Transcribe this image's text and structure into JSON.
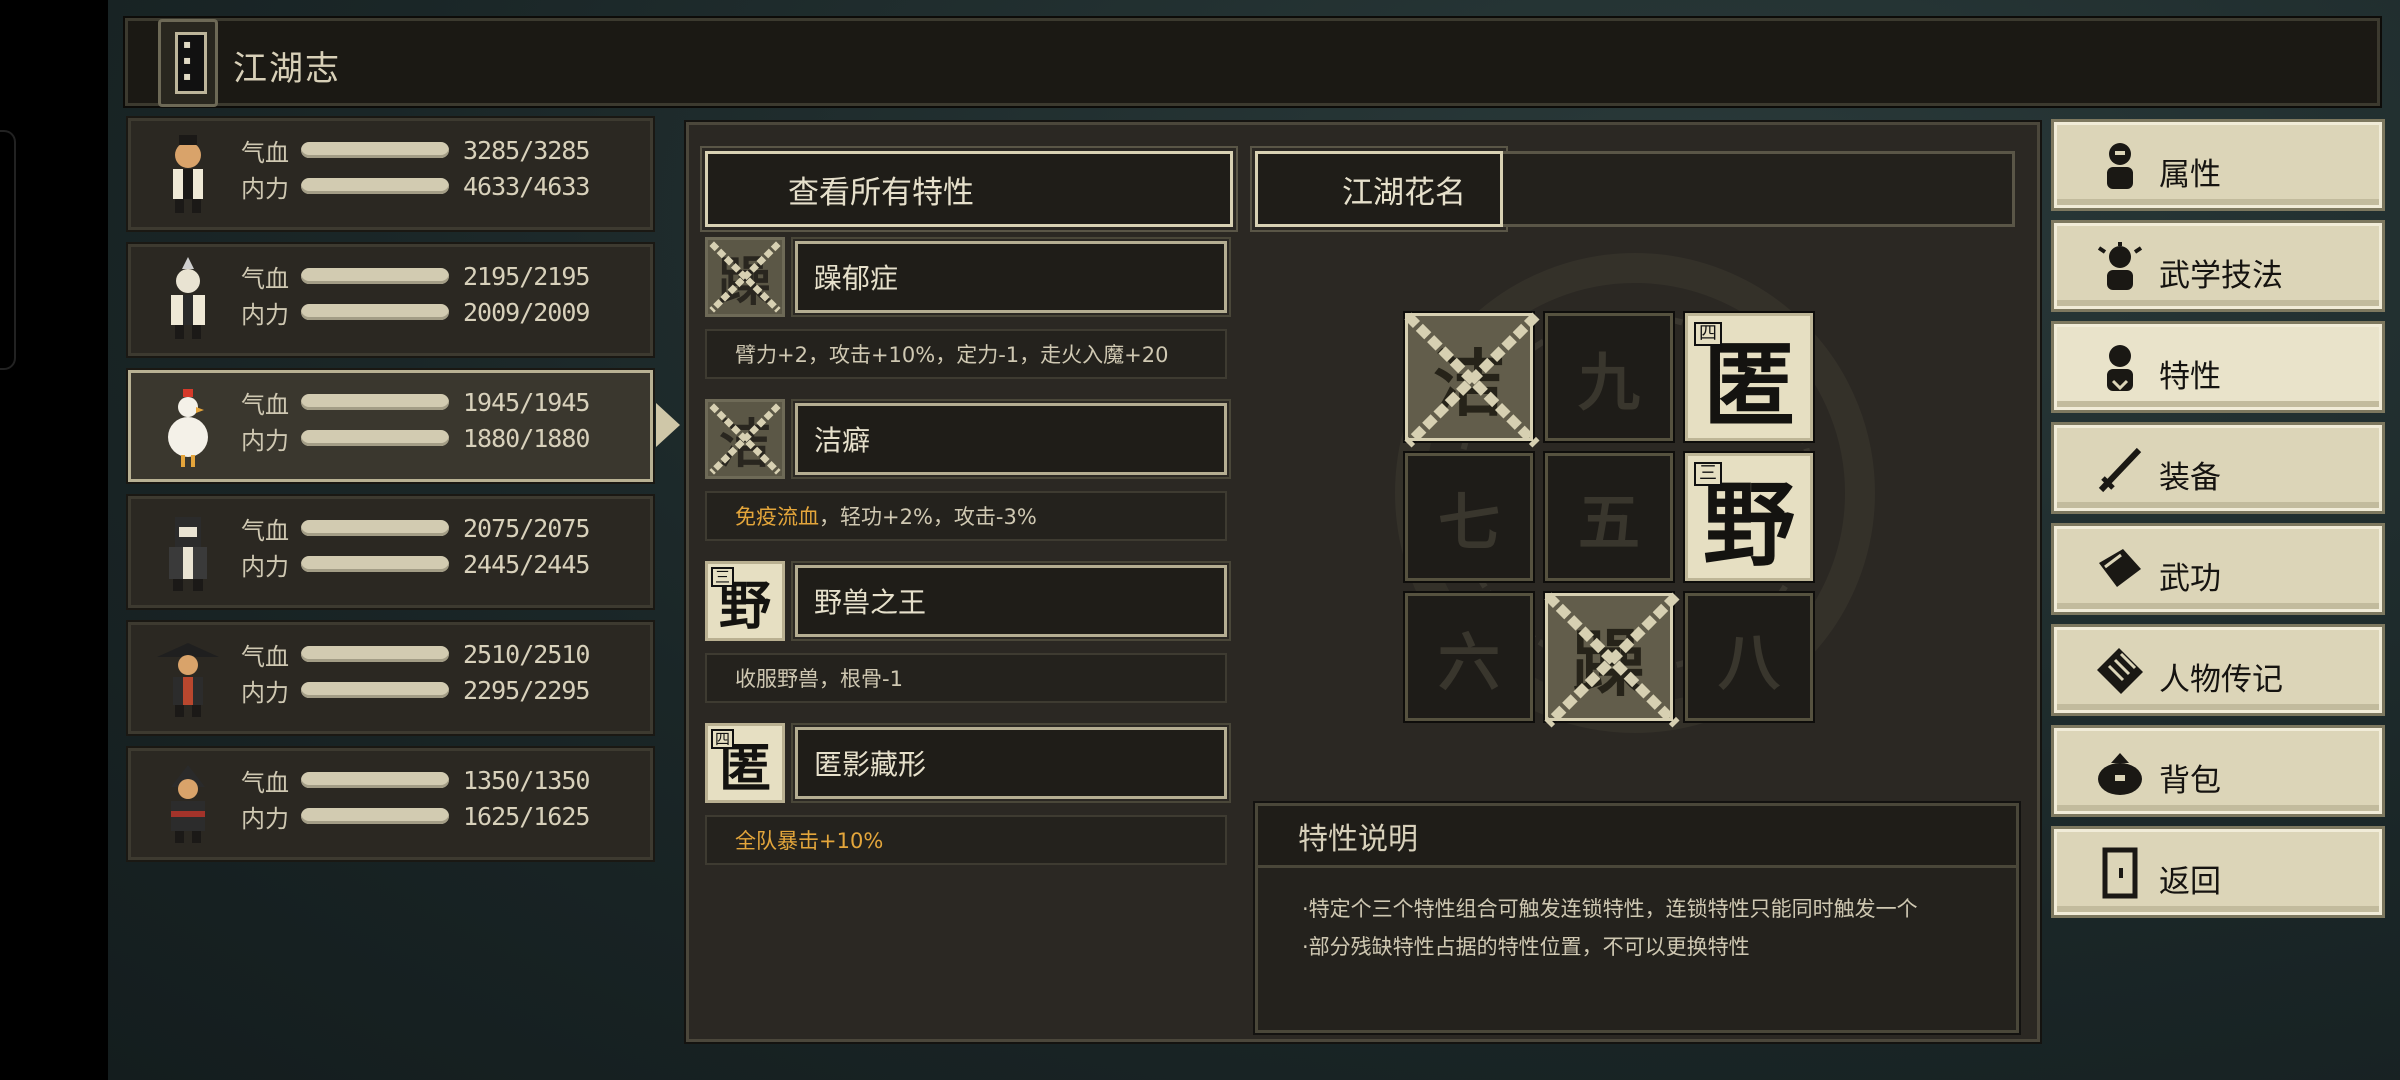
{
  "window_title": "江湖志",
  "party": [
    {
      "hp_label": "气血",
      "mp_label": "内力",
      "hp": "3285/3285",
      "mp": "4633/4633",
      "hp_frac": 1.0,
      "mp_frac": 1.0,
      "avatar": "warrior-avatar"
    },
    {
      "hp_label": "气血",
      "mp_label": "内力",
      "hp": "2195/2195",
      "mp": "2009/2009",
      "hp_frac": 1.0,
      "mp_frac": 1.0,
      "avatar": "monk-avatar"
    },
    {
      "hp_label": "气血",
      "mp_label": "内力",
      "hp": "1945/1945",
      "mp": "1880/1880",
      "hp_frac": 1.0,
      "mp_frac": 1.0,
      "avatar": "chicken-avatar"
    },
    {
      "hp_label": "气血",
      "mp_label": "内力",
      "hp": "2075/2075",
      "mp": "2445/2445",
      "hp_frac": 1.0,
      "mp_frac": 1.0,
      "avatar": "masked-avatar"
    },
    {
      "hp_label": "气血",
      "mp_label": "内力",
      "hp": "2510/2510",
      "mp": "2295/2295",
      "hp_frac": 1.0,
      "mp_frac": 1.0,
      "avatar": "hat-avatar"
    },
    {
      "hp_label": "气血",
      "mp_label": "内力",
      "hp": "1350/1350",
      "mp": "1625/1625",
      "hp_frac": 1.0,
      "mp_frac": 1.0,
      "avatar": "assassin-avatar"
    }
  ],
  "tabs": {
    "all_traits": "查看所有特性",
    "nickname": "江湖花名"
  },
  "traits": [
    {
      "glyph": "躁",
      "name": "躁郁症",
      "desc": "臂力+2，攻击+10%，定力-1，走火入魔+20",
      "highlight": "",
      "locked": true
    },
    {
      "glyph": "洁",
      "name": "洁癖",
      "desc": "，轻功+2%，攻击-3%",
      "highlight": "免疫流血",
      "locked": true
    },
    {
      "glyph": "野",
      "num": "三",
      "name": "野兽之王",
      "desc": "收服野兽，根骨-1",
      "highlight": "",
      "locked": false
    },
    {
      "glyph": "匿",
      "num": "四",
      "name": "匿影藏形",
      "desc": "全队暴击+10%",
      "highlight": "",
      "locked": false
    }
  ],
  "grid": [
    {
      "glyph": "洁",
      "state": "locked"
    },
    {
      "glyph": "九",
      "state": "empty"
    },
    {
      "glyph": "匿",
      "num": "四",
      "state": "gold"
    },
    {
      "glyph": "七",
      "state": "empty"
    },
    {
      "glyph": "五",
      "state": "empty"
    },
    {
      "glyph": "野",
      "num": "三",
      "state": "gold"
    },
    {
      "glyph": "六",
      "state": "empty"
    },
    {
      "glyph": "躁",
      "state": "locked"
    },
    {
      "glyph": "八",
      "state": "empty"
    }
  ],
  "info": {
    "title": "特性说明",
    "line1": "·特定个三个特性组合可触发连锁特性，连锁特性只能同时触发一个",
    "line2": "·部分残缺特性占据的特性位置，不可以更换特性"
  },
  "menu": [
    {
      "label": "属性",
      "icon": "attribute-icon"
    },
    {
      "label": "武学技法",
      "icon": "martial-skill-icon"
    },
    {
      "label": "特性",
      "icon": "trait-icon"
    },
    {
      "label": "装备",
      "icon": "sword-icon"
    },
    {
      "label": "武功",
      "icon": "manual-icon"
    },
    {
      "label": "人物传记",
      "icon": "biography-icon"
    },
    {
      "label": "背包",
      "icon": "bag-icon"
    },
    {
      "label": "返回",
      "icon": "door-icon"
    }
  ],
  "colors": {
    "accent_gold": "#e4a63b",
    "tile_gold": "#e6dfc2",
    "panel_bg": "#2b2823"
  }
}
